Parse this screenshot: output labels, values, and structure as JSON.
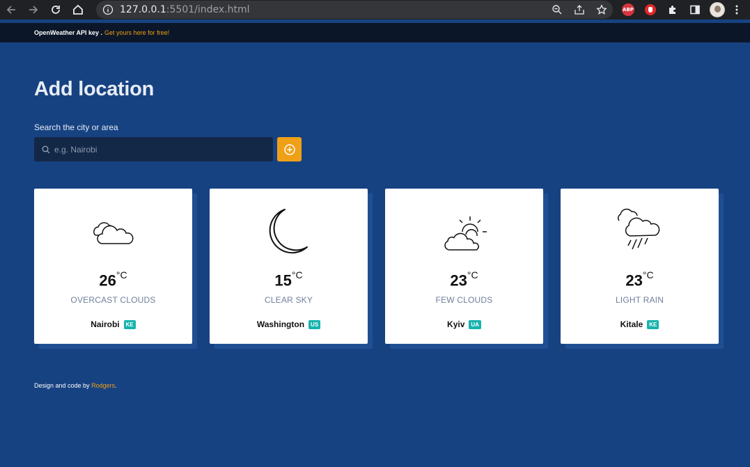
{
  "browser": {
    "url_host": "127.0.0.1",
    "url_rest": ":5501/index.html",
    "extension_abp": "ABP"
  },
  "topbar": {
    "text": "OpenWeather API key .",
    "link": "Get yours here for free!"
  },
  "main": {
    "title": "Add location",
    "search_label": "Search the city or area",
    "search_placeholder": "e.g. Nairobi"
  },
  "cards": [
    {
      "temp": "26",
      "unit": "°C",
      "description": "OVERCAST CLOUDS",
      "city": "Nairobi",
      "country": "KE",
      "icon": "overcast-clouds-icon"
    },
    {
      "temp": "15",
      "unit": "°C",
      "description": "CLEAR SKY",
      "city": "Washington",
      "country": "US",
      "icon": "crescent-moon-icon"
    },
    {
      "temp": "23",
      "unit": "°C",
      "description": "FEW CLOUDS",
      "city": "Kyiv",
      "country": "UA",
      "icon": "sun-behind-clouds-icon"
    },
    {
      "temp": "23",
      "unit": "°C",
      "description": "LIGHT RAIN",
      "city": "Kitale",
      "country": "KE",
      "icon": "rain-clouds-icon"
    }
  ],
  "footer": {
    "text": "Design and code by",
    "author": "Rodgers",
    "period": "."
  },
  "colors": {
    "background": "#174282",
    "accent": "#f0a017",
    "badge": "#17b3ad"
  }
}
